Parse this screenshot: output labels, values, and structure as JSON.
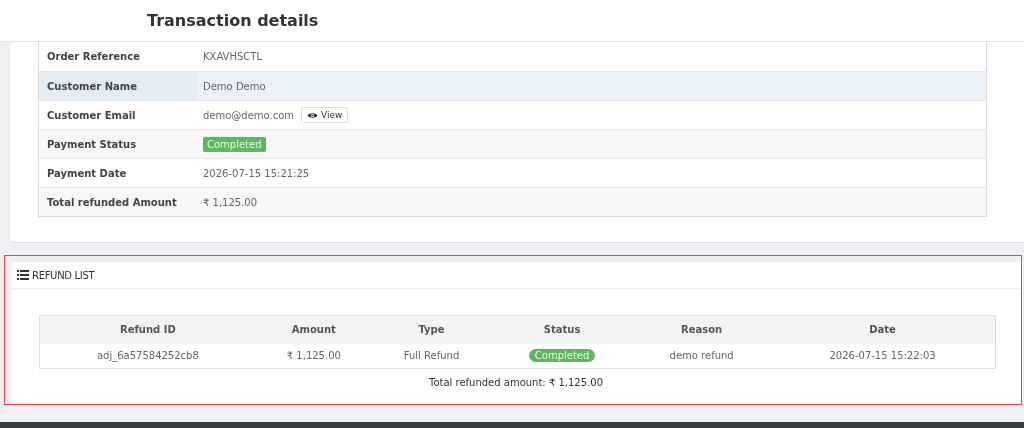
{
  "page_title": "Transaction details",
  "details": [
    {
      "label": "Order Reference",
      "value": "KXAVHSCTL",
      "kind": "text",
      "highlighted": false
    },
    {
      "label": "Customer Name",
      "value": "Demo Demo",
      "kind": "text",
      "highlighted": true
    },
    {
      "label": "Customer Email",
      "value": "demo@demo.com",
      "kind": "email",
      "button": "View",
      "highlighted": false
    },
    {
      "label": "Payment Status",
      "value": "Completed",
      "kind": "badge",
      "highlighted": false
    },
    {
      "label": "Payment Date",
      "value": "2026-07-15 15:21:25",
      "kind": "text",
      "highlighted": false
    },
    {
      "label": "Total refunded Amount",
      "value": "₹ 1,125.00",
      "kind": "text",
      "highlighted": false
    }
  ],
  "refund_panel": {
    "title": "REFUND LIST",
    "columns": [
      "Refund ID",
      "Amount",
      "Type",
      "Status",
      "Reason",
      "Date"
    ],
    "rows": [
      {
        "refund_id": "adj_6a57584252cb8",
        "amount": "₹ 1,125.00",
        "type": "Full Refund",
        "status": "Completed",
        "reason": "demo refund",
        "date": "2026-07-15 15:22:03"
      }
    ],
    "total": "Total refunded amount: ₹ 1,125.00"
  }
}
